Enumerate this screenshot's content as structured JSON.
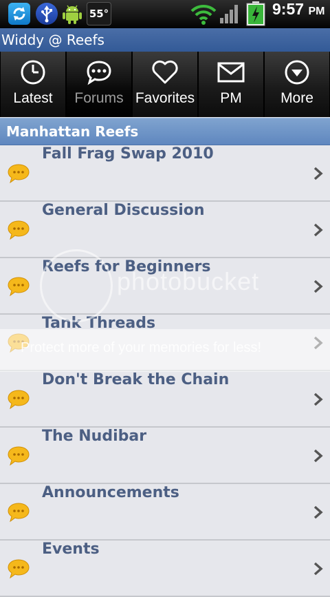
{
  "status_bar": {
    "temperature": "55°",
    "time": "9:57",
    "ampm": "PM",
    "battery_level": "7",
    "icons": [
      "sync-icon",
      "usb-icon",
      "android-icon",
      "weather-icon",
      "wifi-icon",
      "signal-icon",
      "battery-icon"
    ]
  },
  "title_bar": {
    "title": "Widdy @ Reefs"
  },
  "tabs": [
    {
      "label": "Latest",
      "icon": "clock-icon",
      "active": false
    },
    {
      "label": "Forums",
      "icon": "chat-bubble-icon",
      "active": true
    },
    {
      "label": "Favorites",
      "icon": "heart-icon",
      "active": false
    },
    {
      "label": "PM",
      "icon": "envelope-icon",
      "active": false
    },
    {
      "label": "More",
      "icon": "more-arrow-icon",
      "active": false
    }
  ],
  "section": {
    "title": "Manhattan Reefs"
  },
  "forums": [
    {
      "label": "Fall Frag Swap 2010"
    },
    {
      "label": "General Discussion"
    },
    {
      "label": "Reefs for Beginners"
    },
    {
      "label": "Tank Threads"
    },
    {
      "label": "Don't Break the Chain"
    },
    {
      "label": "The Nudibar"
    },
    {
      "label": "Announcements"
    },
    {
      "label": "Events"
    }
  ],
  "watermark": {
    "logo": "photobucket",
    "tagline": "Protect more of your memories for less!"
  },
  "colors": {
    "title_bar": "#3d649f",
    "section_header": "#6f95c7",
    "list_text": "#4c5f83",
    "list_bg": "#e6e7ec",
    "bubble": "#f5b81b"
  }
}
